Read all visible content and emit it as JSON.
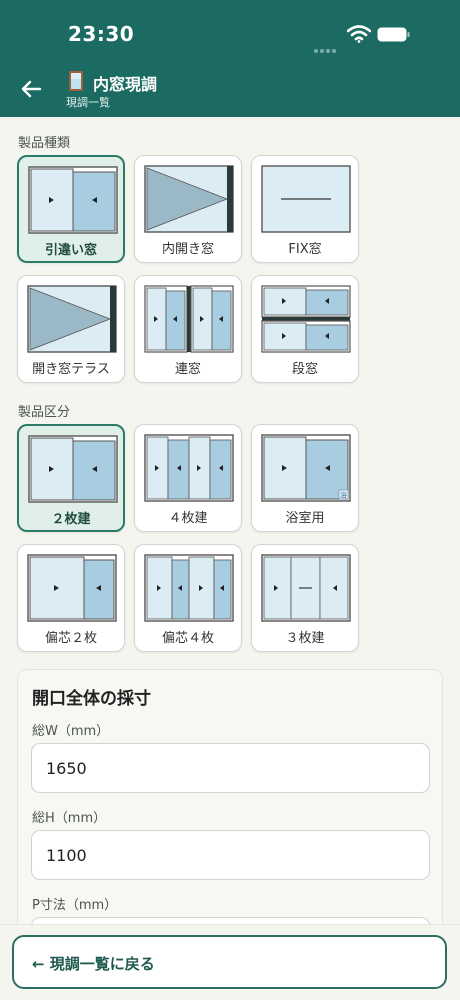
{
  "status": {
    "time": "23:30"
  },
  "header": {
    "title": "内窓現調",
    "subtitle": "現調一覧"
  },
  "product_type": {
    "label": "製品種類",
    "options": [
      "引違い窓",
      "内開き窓",
      "FIX窓",
      "開き窓テラス",
      "連窓",
      "段窓"
    ],
    "selected": "引違い窓"
  },
  "product_division": {
    "label": "製品区分",
    "options": [
      "２枚建",
      "４枚建",
      "浴室用",
      "偏芯２枚",
      "偏芯４枚",
      "３枚建"
    ],
    "selected": "２枚建",
    "bath_mark": "浴"
  },
  "measurement": {
    "title": "開口全体の採寸",
    "total_w_label": "総W（mm）",
    "total_w_value": "1650",
    "total_h_label": "総H（mm）",
    "total_h_value": "1100",
    "p_label": "P寸法（mm）"
  },
  "footer": {
    "back_button": "← 現調一覧に戻る"
  },
  "colors": {
    "header": "#1b6b62",
    "accent": "#2c7a68",
    "pane_light": "#dcecf4",
    "pane_dark": "#a9cde0"
  }
}
